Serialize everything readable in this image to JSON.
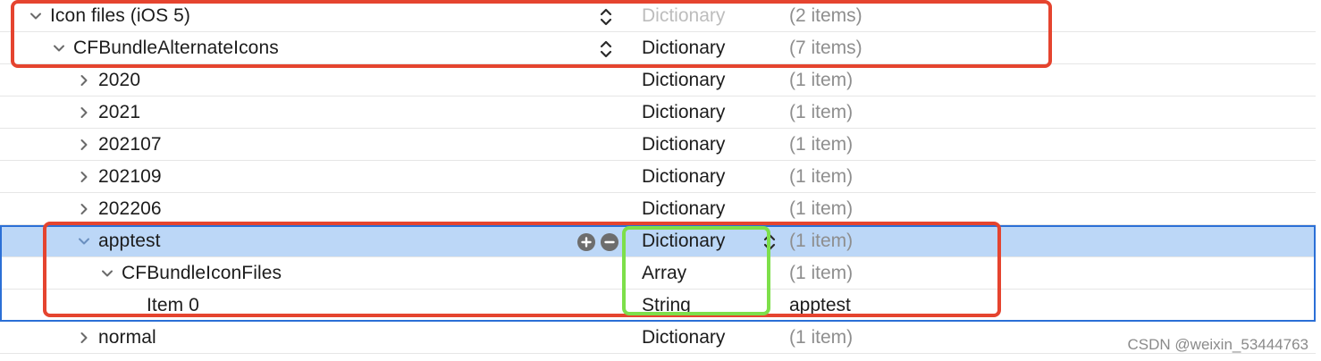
{
  "rows": [
    {
      "key": "Icon files (iOS 5)",
      "type": "Dictionary",
      "value": "(2 items)",
      "expanded": true
    },
    {
      "key": "CFBundleAlternateIcons",
      "type": "Dictionary",
      "value": "(7 items)",
      "expanded": true
    },
    {
      "key": "2020",
      "type": "Dictionary",
      "value": "(1 item)",
      "expanded": false
    },
    {
      "key": "2021",
      "type": "Dictionary",
      "value": "(1 item)",
      "expanded": false
    },
    {
      "key": "202107",
      "type": "Dictionary",
      "value": "(1 item)",
      "expanded": false
    },
    {
      "key": "202109",
      "type": "Dictionary",
      "value": "(1 item)",
      "expanded": false
    },
    {
      "key": "202206",
      "type": "Dictionary",
      "value": "(1 item)",
      "expanded": false
    },
    {
      "key": "apptest",
      "type": "Dictionary",
      "value": "(1 item)",
      "expanded": true,
      "selected": true
    },
    {
      "key": "CFBundleIconFiles",
      "type": "Array",
      "value": "(1 item)",
      "expanded": true
    },
    {
      "key": "Item 0",
      "type": "String",
      "value": "apptest"
    },
    {
      "key": "normal",
      "type": "Dictionary",
      "value": "(1 item)",
      "expanded": false
    }
  ],
  "watermark": "CSDN @weixin_53444763",
  "icons": {
    "expanded": "chevron-down-icon",
    "collapsed": "chevron-right-icon",
    "stepper": "up-down-stepper-icon",
    "add": "plus-circle-icon",
    "remove": "minus-circle-icon"
  },
  "colors": {
    "selection": "#bcd7f7",
    "annotation_red": "#e5442f",
    "annotation_green": "#7ddf4a"
  }
}
